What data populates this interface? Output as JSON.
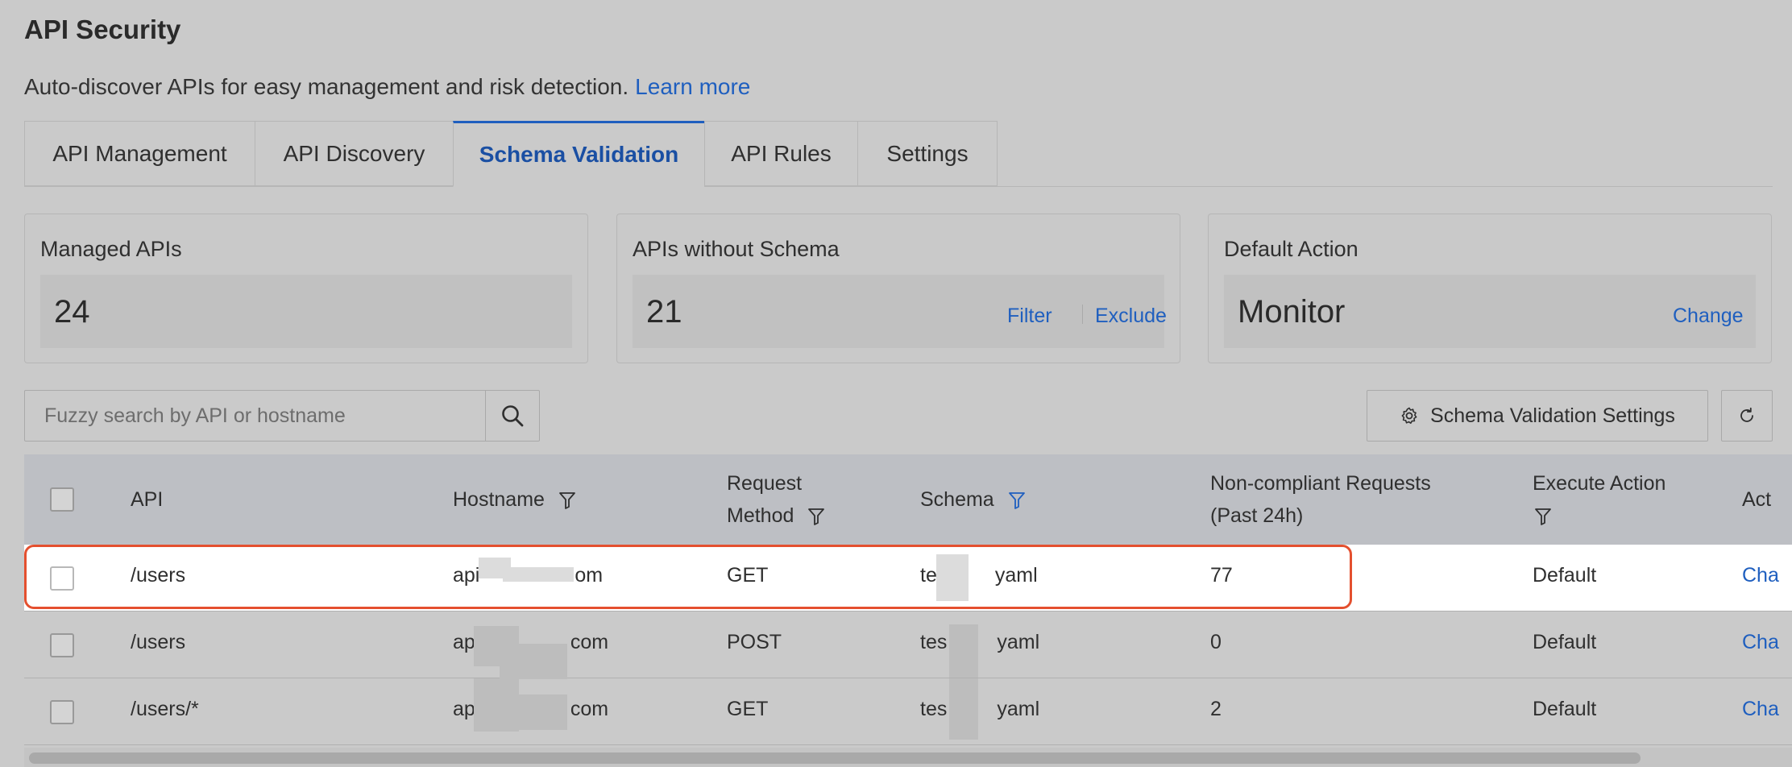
{
  "page": {
    "title": "API Security",
    "description": "Auto-discover APIs for easy management and risk detection.",
    "learn_more": "Learn more"
  },
  "tabs": [
    {
      "label": "API Management",
      "active": false
    },
    {
      "label": "API Discovery",
      "active": false
    },
    {
      "label": "Schema Validation",
      "active": true
    },
    {
      "label": "API Rules",
      "active": false
    },
    {
      "label": "Settings",
      "active": false
    }
  ],
  "cards": {
    "managed": {
      "title": "Managed APIs",
      "value": "24"
    },
    "without_schema": {
      "title": "APIs without Schema",
      "value": "21",
      "filter": "Filter",
      "exclude": "Exclude"
    },
    "default_action": {
      "title": "Default Action",
      "value": "Monitor",
      "change": "Change"
    }
  },
  "toolbar": {
    "search_placeholder": "Fuzzy search by API or hostname",
    "settings_button": "Schema Validation Settings"
  },
  "table": {
    "headers": {
      "api": "API",
      "hostname": "Hostname",
      "request_method_1": "Request",
      "request_method_2": "Method",
      "schema": "Schema",
      "noncompliant_1": "Non-compliant Requests",
      "noncompliant_2": "(Past 24h)",
      "execute_action": "Execute Action",
      "action_partial": "Act"
    },
    "rows": [
      {
        "api": "/users",
        "host_prefix": "api",
        "host_suffix": "om",
        "method": "GET",
        "schema_prefix": "te",
        "schema_suffix": "yaml",
        "noncompliant": "77",
        "action": "Default",
        "op": "Cha"
      },
      {
        "api": "/users",
        "host_prefix": "ap",
        "host_suffix": "com",
        "method": "POST",
        "schema_prefix": "tes",
        "schema_suffix": "yaml",
        "noncompliant": "0",
        "action": "Default",
        "op": "Cha"
      },
      {
        "api": "/users/*",
        "host_prefix": "ap",
        "host_suffix": "com",
        "method": "GET",
        "schema_prefix": "tes",
        "schema_suffix": "yaml",
        "noncompliant": "2",
        "action": "Default",
        "op": "Cha"
      }
    ]
  },
  "colors": {
    "accent": "#1f5fbf",
    "highlight_border": "#e4502f",
    "background": "#cacaca"
  }
}
